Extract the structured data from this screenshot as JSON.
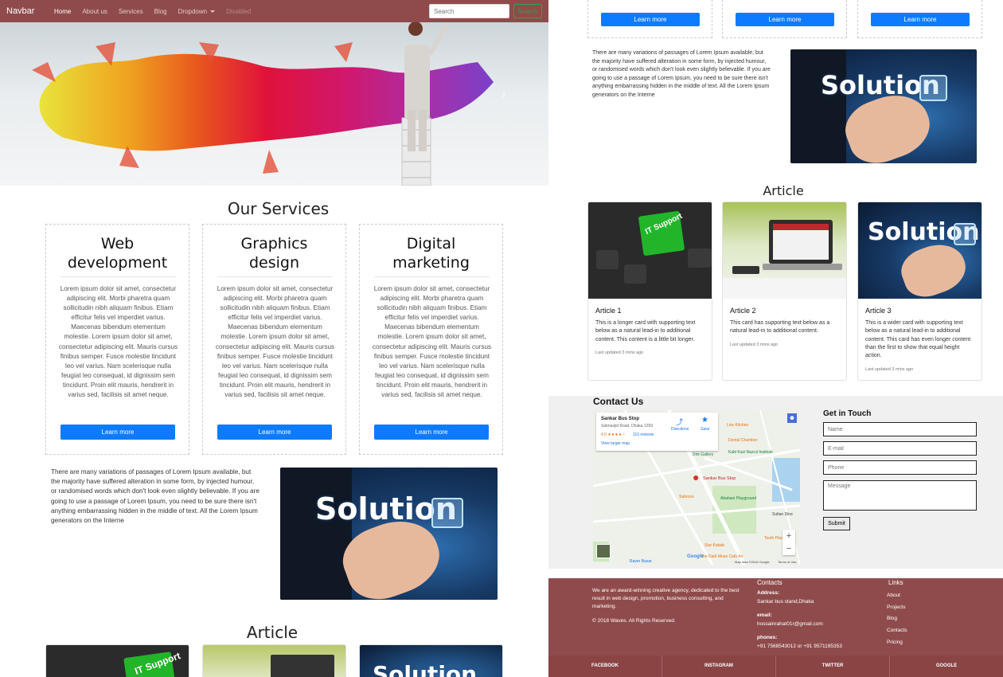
{
  "navbar": {
    "brand": "Navbar",
    "items": [
      {
        "label": "Home"
      },
      {
        "label": "About us"
      },
      {
        "label": "Services"
      },
      {
        "label": "Blog"
      },
      {
        "label": "Dropdown"
      },
      {
        "label": "Disabled"
      }
    ],
    "search_placeholder": "Search",
    "search_button": "Search"
  },
  "services": {
    "title": "Our Services",
    "cards": [
      {
        "title_line1": "Web",
        "title_line2": "development",
        "text": "Lorem ipsum dolor sit amet, consectetur adipiscing elit. Morbi pharetra quam sollicitudin nibh aliquam finibus. Etiam efficitur felis vel imperdiet varius. Maecenas bibendum elementum molestie. Lorem ipsum dolor sit amet, consectetur adipiscing elit. Mauris cursus finibus semper. Fusce molestie tincidunt leo vel varius. Nam scelerisque nulla feugiat leo consequat, id dignissim sem tincidunt. Proin elit mauris, hendrerit in varius sed, facilisis sit amet neque.",
        "button": "Learn more"
      },
      {
        "title_line1": "Graphics",
        "title_line2": "design",
        "text": "Lorem ipsum dolor sit amet, consectetur adipiscing elit. Morbi pharetra quam sollicitudin nibh aliquam finibus. Etiam efficitur felis vel imperdiet varius. Maecenas bibendum elementum molestie. Lorem ipsum dolor sit amet, consectetur adipiscing elit. Mauris cursus finibus semper. Fusce molestie tincidunt leo vel varius. Nam scelerisque nulla feugiat leo consequat, id dignissim sem tincidunt. Proin elit mauris, hendrerit in varius sed, facilisis sit amet neque.",
        "button": "Learn more"
      },
      {
        "title_line1": "Digital",
        "title_line2": "marketing",
        "text": "Lorem ipsum dolor sit amet, consectetur adipiscing elit. Morbi pharetra quam sollicitudin nibh aliquam finibus. Etiam efficitur felis vel imperdiet varius. Maecenas bibendum elementum molestie. Lorem ipsum dolor sit amet, consectetur adipiscing elit. Mauris cursus finibus semper. Fusce molestie tincidunt leo vel varius. Nam scelerisque nulla feugiat leo consequat, id dignissim sem tincidunt. Proin elit mauris, hendrerit in varius sed, facilisis sit amet neque.",
        "button": "Learn more"
      }
    ]
  },
  "about": {
    "text": "There are many variations of passages of Lorem Ipsum available, but the majority have suffered alteration in some form, by injected humour, or randomised words which don't look even slightly believable. If you are going to use a passage of Lorem Ipsum, you need to be sure there isn't anything embarrassing hidden in the middle of text. All the Lorem Ipsum generators on the Interne",
    "image_word": "Solution"
  },
  "articles": {
    "title": "Article",
    "cards": [
      {
        "title": "Article 1",
        "text": "This is a longer card with supporting text below as a natural lead-in to additional content. This content is a little bit longer.",
        "updated": "Last updated 3 mins ago",
        "image_label": "IT Support"
      },
      {
        "title": "Article 2",
        "text": "This card has supporting text below as a natural lead-in to additional content.",
        "updated": "Last updated 3 mins ago"
      },
      {
        "title": "Article 3",
        "text": "This is a wider card with supporting text below as a natural lead-in to additional content. This card has even longer content than the first to show that equal height action.",
        "updated": "Last updated 3 mins ago",
        "image_word": "Solution"
      }
    ]
  },
  "contact": {
    "title": "Contact Us",
    "map": {
      "place": "Sankar Bus Stop",
      "address": "Satmasjid Road, Dhaka 1209",
      "rating": "4.0",
      "reviews": "110 reviews",
      "larger_map": "View larger map",
      "directions": "Directions",
      "save": "Save",
      "pin_label": "Sankar Bus Stop",
      "pois": [
        "Live Kitchen",
        "Dental Chamber",
        "Drik Gallery",
        "Kabi Kazi Nazrul Institute",
        "Sabroso",
        "Abahani Playground",
        "Star Kabab",
        "Sultan Dine",
        "Tooth Planet",
        "Raver Bazar",
        "The Dark Muse Cafe An"
      ],
      "zoom_in": "+",
      "zoom_out": "−",
      "attribution": "Map data ©2018 Google",
      "terms": "Terms of Use",
      "google": "Google"
    },
    "form": {
      "title": "Get in Touch",
      "name_placeholder": "Name",
      "email_placeholder": "E-mail",
      "phone_placeholder": "Phone",
      "message_placeholder": "Message",
      "submit": "Submit"
    }
  },
  "footer": {
    "about_text": "We are an award-winning creative agency, dedicated to the best result in web design, promotion, business consulting, and marketing.",
    "copyright": "©  2018 Waves. All Rights Reserved.",
    "contacts_title": "Contacts",
    "address_label": "Address:",
    "address_value": "Sankar bus stand,Dhaka",
    "email_label": "email:",
    "email_value": "hossainrahat01r@gmail.com",
    "phones_label": "phones:",
    "phones_value": "+91 7568543012 or +91 9571195353",
    "links_title": "Links",
    "links": [
      "About",
      "Projects",
      "Blog",
      "Contacts",
      "Pricing"
    ],
    "social": [
      "FACEBOOK",
      "INSTAGRAM",
      "TWITTER",
      "GOOGLE"
    ]
  },
  "colors": {
    "navbar": "#8f4b4b",
    "primary_button": "#0d7bff",
    "footer": "#8f4b4b"
  }
}
